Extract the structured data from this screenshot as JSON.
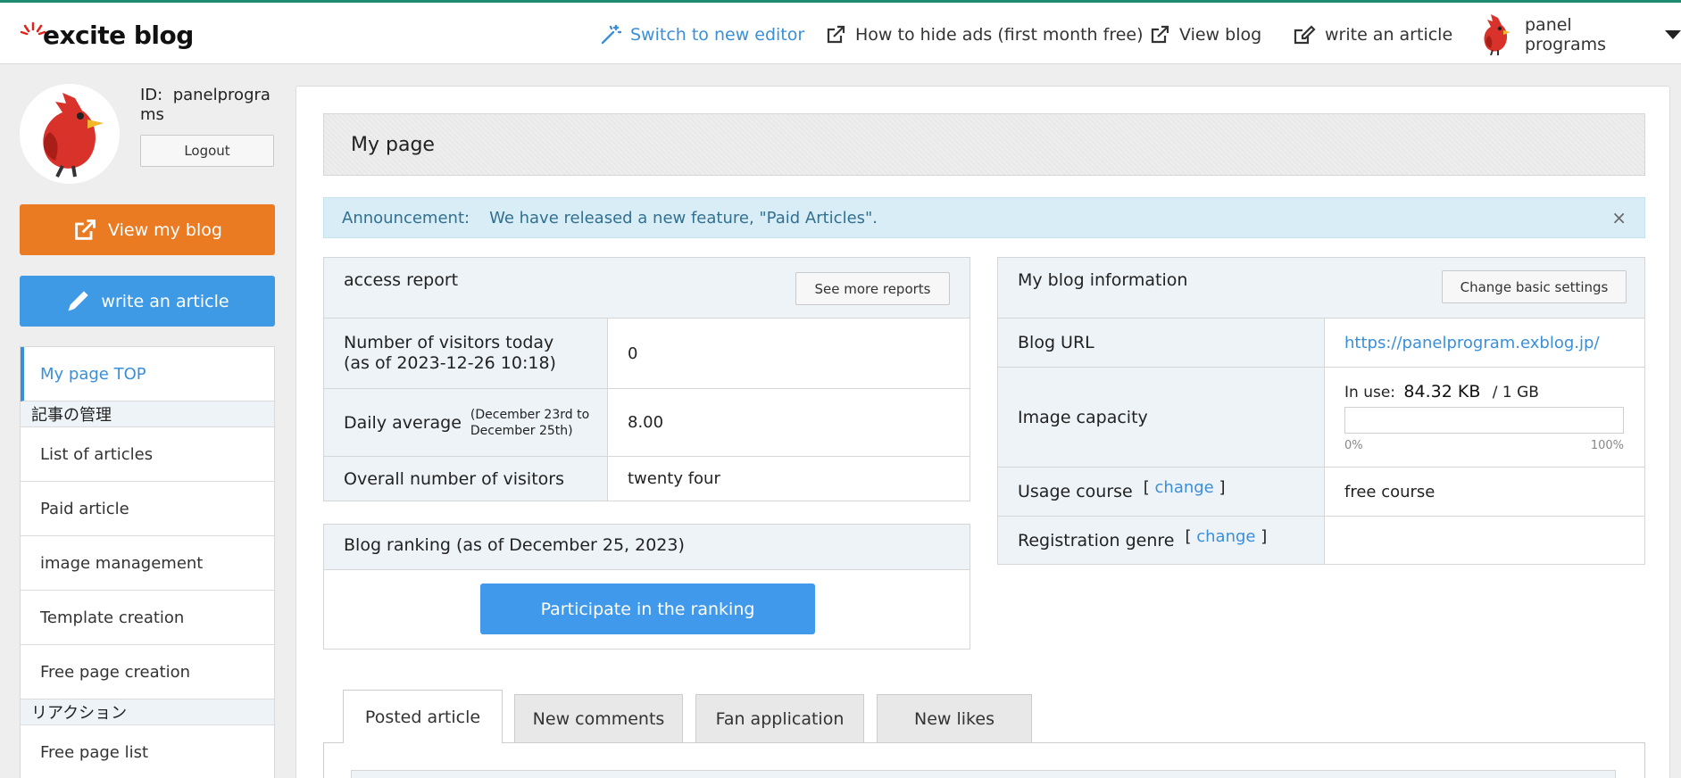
{
  "header": {
    "logo": "excite blog",
    "switch_editor": "Switch to new editor",
    "hide_ads": "How to hide ads (first month free)",
    "view_blog": "View blog",
    "write_article": "write an article",
    "user_name": "panel programs"
  },
  "sidebar": {
    "user_id_label": "ID:",
    "user_id": "panelprograms",
    "logout": "Logout",
    "view_my_blog": "View my blog",
    "write_article": "write an article",
    "menu": {
      "top": "My page TOP",
      "section_articles": "記事の管理",
      "list_articles": "List of articles",
      "paid_article": "Paid article",
      "image_management": "image management",
      "template_creation": "Template creation",
      "free_page_creation": "Free page creation",
      "section_reaction": "リアクション",
      "free_page_list": "Free page list"
    }
  },
  "main": {
    "title": "My page",
    "announcement_label": "Announcement:",
    "announcement_text": "We have released a new feature, \"Paid Articles\".",
    "close": "×",
    "access": {
      "title": "access report",
      "more_button": "See more reports",
      "rows": [
        {
          "label": "Number of visitors today",
          "sublabel": "(as of 2023-12-26 10:18)",
          "value": "0"
        },
        {
          "label": "Daily average",
          "note": "(December 23rd to December 25th)",
          "value": "8.00"
        },
        {
          "label": "Overall number of visitors",
          "value": "twenty four"
        }
      ]
    },
    "ranking": {
      "title": "Blog ranking (as of December 25, 2023)",
      "button": "Participate in the ranking"
    },
    "info": {
      "title": "My blog information",
      "settings_button": "Change basic settings",
      "blog_url_label": "Blog URL",
      "blog_url": "https://panelprogram.exblog.jp/",
      "image_capacity_label": "Image capacity",
      "in_use_label": "In use:",
      "in_use_value": "84.32 KB",
      "capacity_total": "/ 1 GB",
      "pct_min": "0%",
      "pct_max": "100%",
      "usage_course_label": "Usage course",
      "change_label": "change",
      "usage_course_value": "free course",
      "registration_genre_label": "Registration genre",
      "registration_genre_value": ""
    },
    "tabs": [
      "Posted article",
      "New comments",
      "Fan application",
      "New likes"
    ]
  }
}
